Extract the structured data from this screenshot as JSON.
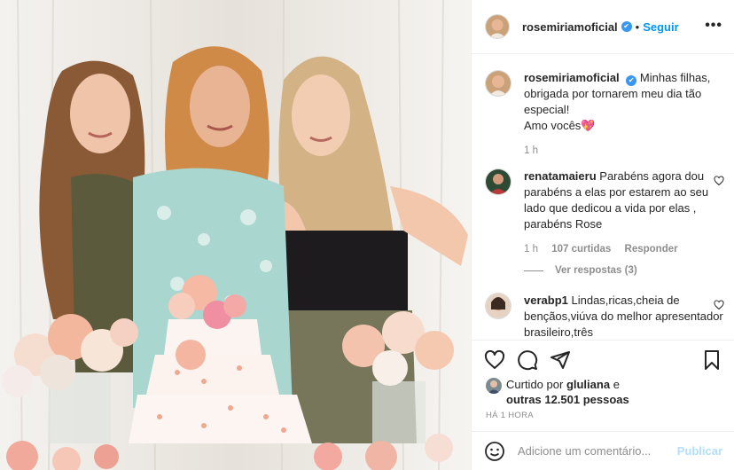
{
  "header": {
    "username": "rosemiriamoficial",
    "follow_label": "Seguir",
    "more": "•••"
  },
  "caption": {
    "username": "rosemiriamoficial",
    "text_line1": "Minhas filhas, obrigada por tornarem meu dia tão especial!",
    "text_line2": "Amo vocês💖",
    "time": "1 h"
  },
  "comments": [
    {
      "username": "renatamaieru",
      "text": "Parabéns agora dou parabéns a elas por estarem ao seu lado que dedicou a vida por elas , parabéns Rose",
      "time": "1 h",
      "likes": "107 curtidas",
      "reply": "Responder"
    },
    {
      "username": "verabp1",
      "text": "Lindas,ricas,cheia de bençãos,viúva do melhor apresentador brasileiro,três",
      "time": "",
      "likes": "",
      "reply": ""
    }
  ],
  "view_replies": "Ver respostas (3)",
  "likes": {
    "prefix": "Curtido por",
    "user": "gluliana",
    "middle": "e",
    "others": "outras 12.501 pessoas"
  },
  "timestamp": "HÁ 1 HORA",
  "add_comment": {
    "placeholder": "Adicione um comentário...",
    "publish": "Publicar"
  },
  "icons": {
    "like": "heart-icon",
    "comment": "comment-icon",
    "share": "paper-plane-icon",
    "save": "bookmark-icon",
    "emoji": "smiley-icon",
    "options": "more-icon"
  },
  "colors": {
    "accent": "#0095f6",
    "verified": "#3897f0",
    "muted": "#8e8e8e",
    "publish_disabled": "#b2dffc"
  }
}
